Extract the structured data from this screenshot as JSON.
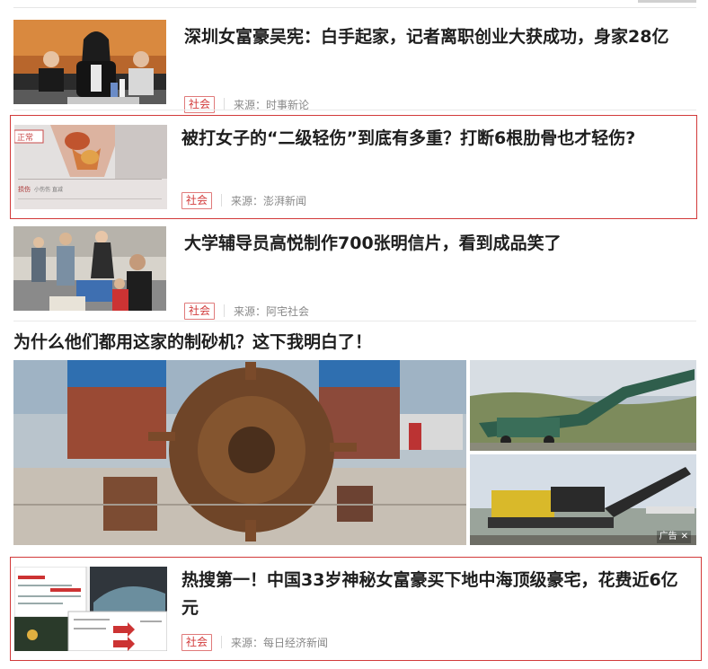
{
  "news": [
    {
      "title": "深圳女富豪吴宪：白手起家，记者离职创业大获成功，身家28亿",
      "tag": "社会",
      "source": "来源：时事新论",
      "highlighted": false
    },
    {
      "title": "被打女子的“二级轻伤”到底有多重？打断6根肋骨也才轻伤?",
      "tag": "社会",
      "source": "来源：澎湃新闻",
      "highlighted": true,
      "thumb_text": [
        "正常",
        "损伤",
        "小伤伤 直减"
      ]
    },
    {
      "title": "大学辅导员高悦制作700张明信片，看到成品笑了",
      "tag": "社会",
      "source": "来源：阿宅社会",
      "highlighted": false
    },
    {
      "title": "热搜第一！中国33岁神秘女富豪买下地中海顶级豪宅，花费近6亿元",
      "tag": "社会",
      "source": "来源：每日经济新闻",
      "highlighted": true
    }
  ],
  "ad": {
    "title": "为什么他们都用这家的制砂机？这下我明白了！",
    "ad_label": "广告",
    "close_glyph": "✕"
  },
  "colors": {
    "accent": "#d23a3a",
    "tag_border": "#e07a7a",
    "meta": "#888888"
  }
}
